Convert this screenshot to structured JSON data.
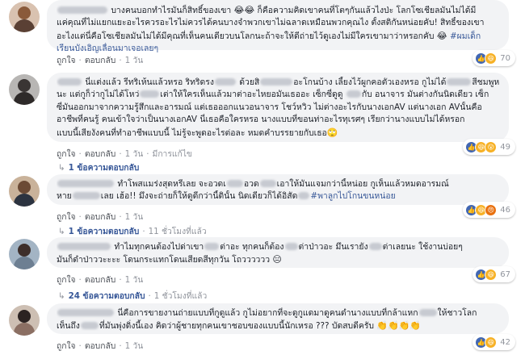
{
  "actions": {
    "like": "ถูกใจ",
    "reply": "ตอบกลับ",
    "edited": "มีการแก้ไข",
    "separator": "·"
  },
  "colors": {
    "bubble_bg": "#f2f3f5",
    "name_link": "#385898",
    "meta_gray": "#90949c",
    "like_blue": "#4267b2",
    "haha_yellow": "#f7b125"
  },
  "comments": [
    {
      "lines": [
        [
          "บางคนบอกทำไรมันก็สิทธิ์ของเขา ",
          "😂😂",
          " ก็คือความคิดเขาคนที่โตๆกันแล้วไงป่ะ โลกโซเชียลมันไม่ได้มี"
        ],
        [
          "แค่คุณที่ไม่แยกแยะอะไรควรอะไรไม่ควรได้คนบางจำพวกเขาไม่ฉลาดเหมือนพวกคุณไง ตั้งสติกันหน่อยคับ! สิทธิ์ของเขา"
        ],
        [
          "อะไงแต่นี่คือโซเชียลมันไม่ได้มีคุณที่เห็นคนเดียวบนโลกนะถ้าจะให้ดีถ่ายไว้ดูเองไม่มีใครเขามาว่าหรอกคับ ",
          "😂",
          " #ผมเด็ก"
        ],
        [
          "เรียนบังเอิญเลื่อนมาเจอเลยๆ"
        ]
      ],
      "time": "",
      "reactions": [
        "like-icon",
        "haha-icon"
      ],
      "reaction_count": "70",
      "replies_label": "",
      "replies_time": ""
    },
    {
      "lines": [
        [
          "นี่แต่งแล้ว รีทริเห้นแล้วหรอ ริทริดรง",
          " ด้วยสิ",
          "อะโกนบ้าง เลี้ยงไว้ผูกคอตัวเองหรอ กูไม่ได้",
          "สีชมพูหรอก"
        ],
        [
          "นะ แต่กูก็ว่ากูไม่ได้โหว่",
          "เต่าให้ใครเห็นแล้วมาต่าอะไหยอมันเธออะ เซ็กซี่ดูดู ",
          "กับ อนาจาร มันต่างกันนิดเดียว เซ็ก"
        ],
        [
          "ซี่มันออกมาจากความรู้สึกและอารมณ์ แต่เธอออกแนวอนาจาร โชว์หวิว ไม่ต่างอะไรกับนางเอกAV แต่นางเอก AVนั้นคือ"
        ],
        [
          "อาชีพที่คนรู้ คนเข้าใจว่าเป็นนางเอกAV นี่เธอคือใครหรอ นางแบบที่ขอนท่าอะไรทุเรศๆ เรียกว่านางแบบไม่ได้หรอก"
        ],
        [
          "แบบนี้เสียงังคนที่ทำอาชีพแบบนี้ ไม่รู้จะพูดอะไรต่อละ หมดคำบรรยายกับเธอ",
          "🙄"
        ]
      ],
      "time": "",
      "reactions": [
        "like-icon",
        "haha-icon",
        "wow-icon"
      ],
      "reaction_count": "49",
      "replies_label": "1 ข้อความตอบกลับ",
      "replies_time": ""
    },
    {
      "lines": [
        [
          "ทำโพสแมร่งสุดหรีเลย จะอวดเ",
          "อวด",
          "เอาให้มันแจมกว่านี้หน่อย กูเห็นแล้วหมดอารมณ์"
        ],
        [
          "หาย",
          "เลย เฮ้อ!! มึงจะถ่ายก็ให้ดูดีกว่านี้ดินั้น นิดเดียวก็ได้อิสัด",
          "#พาลูกไปโกนขนหน่อย"
        ]
      ],
      "time": "",
      "reactions": [
        "like-icon",
        "haha-icon",
        "angry-icon"
      ],
      "reaction_count": "46",
      "replies_label": "1 ข้อความตอบกลับ",
      "replies_time": "11 ชั่วโมงที่แล้ว"
    },
    {
      "lines": [
        [
          "ทำไมทุกคนต้องไปด่าเขา",
          "ต่าอะ ทุกคนก็ต้อง",
          "ต่าป่าวอะ มึนเรายัง",
          "ต่าเลยนะ ใช้งานบ่อยๆ"
        ],
        [
          "มันก็ดำป่าววะะะะ โดนกระแทกโดนเสียดสีทุกวัน โถวววววว ",
          "😑"
        ]
      ],
      "time": "",
      "reactions": [
        "like-icon",
        "haha-icon"
      ],
      "reaction_count": "67",
      "replies_label": "24 ข้อความตอบกลับ",
      "replies_time": "1 ชั่วโมงที่แล้ว"
    },
    {
      "lines": [
        [
          "นี่คือการขายงานถ่ายแบบที่กูดูแล้ว กูไม่อยากที่จะดูกูแดมาดูคนดำนางแบบที่กล้าแหก",
          "ให้ชาวโลก"
        ],
        [
          "เห็นถึง",
          "ที่มันพุ่งดิ่งนี้เอง คิดว่าผู้ชายทุกคนเขาชอบของแบบนี้นักเหรอ ??? บัดสบดีครับ ",
          "👏👏👏👏"
        ]
      ],
      "time": "",
      "reactions": [
        "like-icon",
        "haha-icon"
      ],
      "reaction_count": "42",
      "replies_label": "",
      "replies_time": ""
    }
  ],
  "times": {
    "c1": "",
    "c2": "",
    "c3": "",
    "c4": "",
    "c5": ""
  },
  "meta": {
    "c2_time": "",
    "c3_actions_time": "",
    "c4_actions_time": ""
  },
  "extra": {
    "c1_time": "",
    "c2_time": "1 วัน",
    "c3_time": "1 วัน",
    "c4_time": "1 วัน",
    "c5_time": "1 วัน",
    "c1_edit": "",
    "c2_edit": "มีการแก้ไข",
    "reply_arrow": "↳"
  }
}
